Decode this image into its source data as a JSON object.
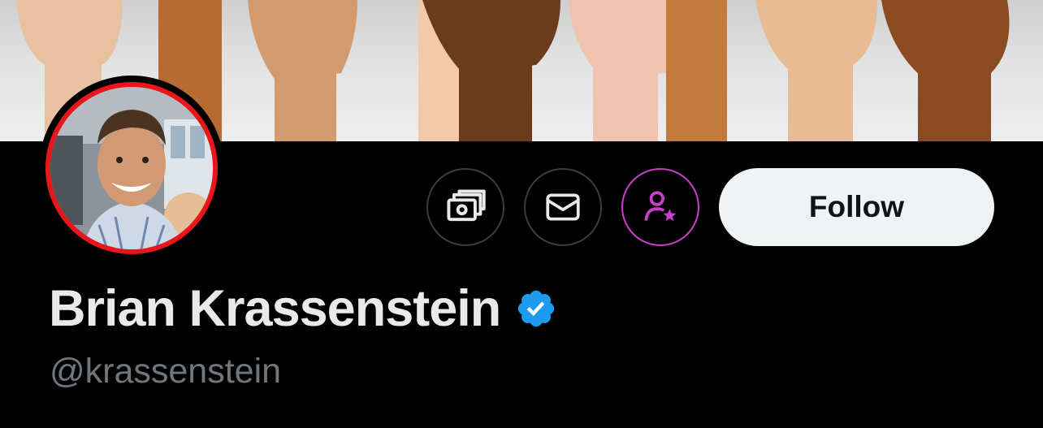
{
  "profile": {
    "display_name": "Brian Krassenstein",
    "handle": "@krassenstein",
    "verified": true
  },
  "actions": {
    "follow_label": "Follow",
    "icons": [
      "money-icon",
      "envelope-icon",
      "subscribe-icon"
    ]
  },
  "colors": {
    "background": "#000000",
    "avatar_ring": "#e8161b",
    "verified_badge": "#1d9bf0",
    "subscribe_accent": "#c93fc9",
    "follow_button_bg": "#eff3f4",
    "name_text": "#e7e9ea",
    "handle_text": "#71767b"
  }
}
